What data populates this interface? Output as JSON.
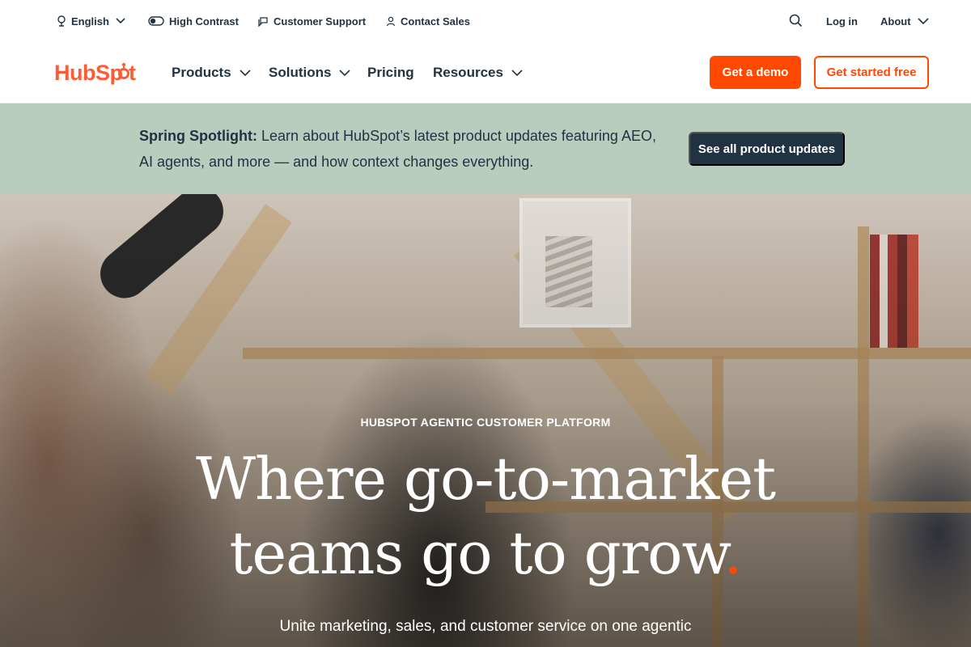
{
  "utility": {
    "language": "English",
    "contrast": "High Contrast",
    "support": "Customer Support",
    "sales": "Contact Sales",
    "login": "Log in",
    "about": "About"
  },
  "nav": {
    "logo": "HubSpot",
    "items": [
      {
        "label": "Products"
      },
      {
        "label": "Solutions"
      },
      {
        "label": "Pricing"
      },
      {
        "label": "Resources"
      }
    ],
    "demo": "Get a demo",
    "free": "Get started free"
  },
  "announcement": {
    "bold": "Spring Spotlight:",
    "text": " Learn about HubSpot’s latest product updates featuring AEO, AI agents, and more — and how context changes everything.",
    "button": "See all product updates"
  },
  "hero": {
    "eyebrow": "HUBSPOT AGENTIC CUSTOMER PLATFORM",
    "headline_line1": "Where go-to-market",
    "headline_line2": "teams go to grow",
    "headline_dot": ".",
    "subline": "Unite marketing, sales, and customer service on one agentic"
  },
  "colors": {
    "brand_orange": "#ff4800",
    "navy": "#213343",
    "banner_green": "#b9cdbe"
  }
}
